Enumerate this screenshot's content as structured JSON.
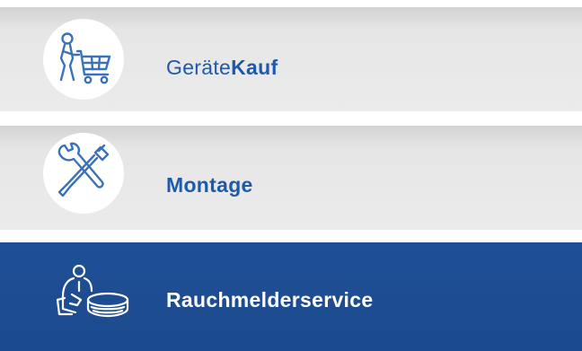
{
  "menu": {
    "items": [
      {
        "label_light": "Geräte",
        "label_bold": "Kauf",
        "icon": "shopping-cart-person-icon",
        "active": false
      },
      {
        "label": "Montage",
        "icon": "tools-icon",
        "active": false
      },
      {
        "label": "Rauchmelderservice",
        "icon": "person-smoke-detector-icon",
        "active": true
      }
    ]
  },
  "colors": {
    "accent_blue": "#1f4f96",
    "label_blue": "#1f5aa6",
    "tile_grey": "#e6e6e6",
    "icon_blue": "#3a72b8"
  }
}
